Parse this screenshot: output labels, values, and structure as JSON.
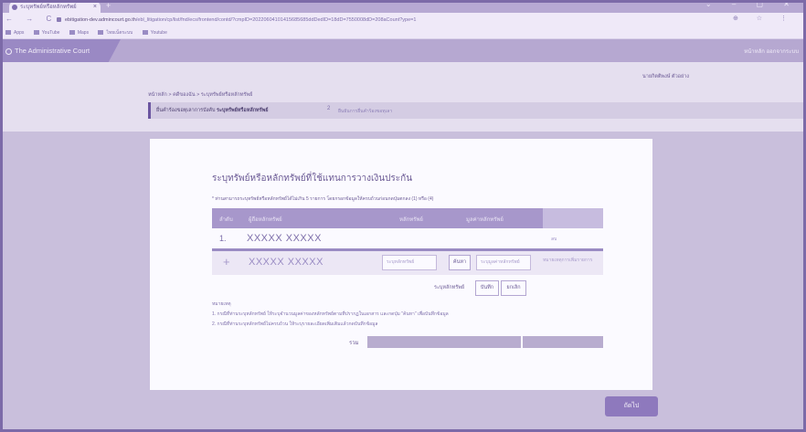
{
  "browser": {
    "tab_title": "ระบุทรัพย์หรือหลักทรัพย์",
    "tab_close": "×",
    "new_tab": "+",
    "window_controls": "⌄ – ▢ ✕",
    "nav_buttons": "← → C",
    "url_host": "ebitigation-dev.admincourt.go.th",
    "url_rest": "/ebl_litigation/cp/list/fnd/ecs/frontend/contd/?cmpID=20220604101415685685ddDedID=18dD=7550008dD=208aCount?ype=1",
    "right_icons": "⊕ ☆ ⋮",
    "bookmarks": [
      "Apps",
      "YouTube",
      "Maps",
      "ไทยเน็ตระบบ",
      "Youtube"
    ]
  },
  "header": {
    "logo_text": "The Administrative Court",
    "links": "หน้าหลัก  ออกจากระบบ"
  },
  "user_name": "นายกิตติพงษ์ ตัวอย่าง",
  "breadcrumb": "หน้าหลัก  >  คดีของฉัน  >  ระบุทรัพย์หรือหลักทรัพย์",
  "stepbar": {
    "active_prefix": "ยื่นคำร้องขอทุเลาการบังคับ",
    "active_bold": "ระบุทรัพย์หรือหลักทรัพย์",
    "step_num": "2",
    "next": "ยืนยันการยื่นคำร้องขอทุเลา"
  },
  "card": {
    "title": "ระบุทรัพย์หรือหลักทรัพย์ที่ใช้แทนการวางเงินประกัน",
    "note": "* ท่านสามารถระบุทรัพย์หรือหลักทรัพย์ได้ไม่เกิน 5 รายการ โดยกรอกข้อมูลให้ครบถ้วนก่อนกดปุ่มตกลง (1) หรือ (4)",
    "columns": [
      "ลำดับ",
      "ผู้ถือหลักทรัพย์",
      "หลักทรัพย์",
      "มูลค่าหลักทรัพย์"
    ],
    "rows": [
      {
        "no": "1.",
        "name": "XXXXX  XXXXX",
        "action": "ลบ"
      }
    ],
    "new_row": {
      "plus": "+",
      "name": "XXXXX  XXXXX",
      "asset_placeholder": "ระบุหลักทรัพย์",
      "select_button": "ค้นหา",
      "value_placeholder": "ระบุมูลค่าหลักทรัพย์",
      "hint": "หมายเหตุการเพิ่มรายการ"
    },
    "sum_row": {
      "label": "ระบุหลักทรัพย์",
      "save_button": "บันทึก",
      "cancel_button": "ยกเลิก"
    },
    "notes_title": "หมายเหตุ",
    "notes": [
      "1. กรณีที่ท่านระบุหลักทรัพย์ ให้ระบุจำนวนมูลค่าของหลักทรัพย์ตามที่ปรากฏในเอกสาร และกดปุ่ม \"ค้นหา\" เพื่อบันทึกข้อมูล",
      "2. กรณีที่ท่านระบุหลักทรัพย์ไม่ครบถ้วน ให้ระบุรายละเอียดเพิ่มเติมแล้วกดบันทึกข้อมูล"
    ],
    "total_label": "รวม"
  },
  "next_button": "ถัดไป"
}
